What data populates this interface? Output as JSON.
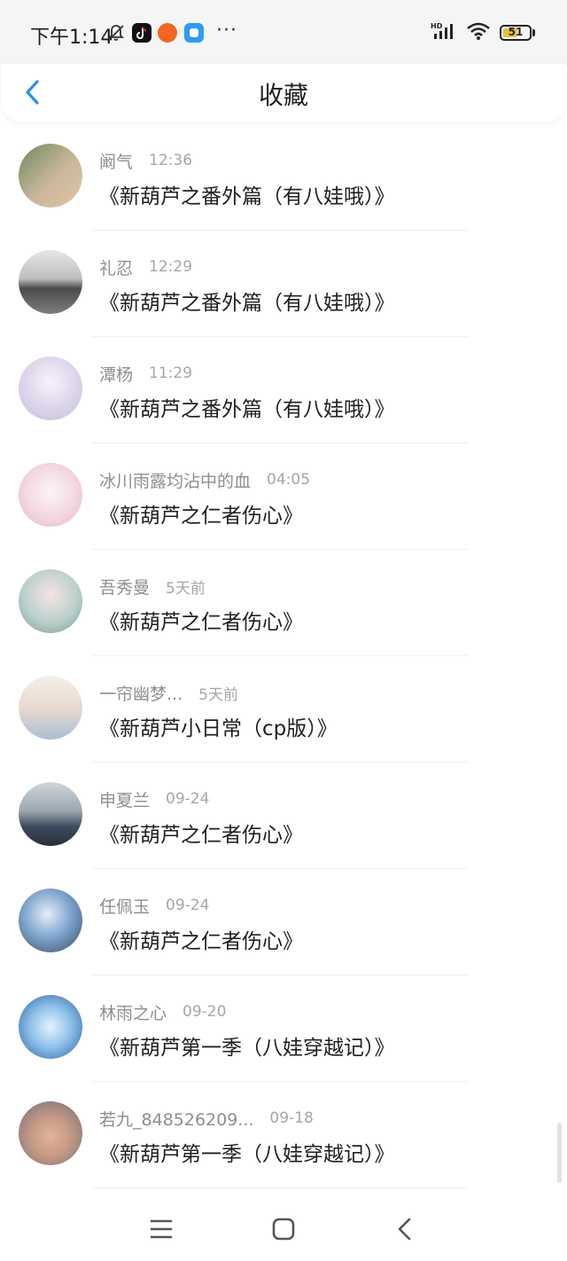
{
  "status_bar": {
    "time": "下午1:14",
    "icons": [
      "mute-bell-icon",
      "tiktok-app-icon",
      "pumpkin-app-icon",
      "blue-app-icon",
      "more-dots-icon",
      "hd-signal-icon",
      "wifi-icon",
      "battery-icon"
    ],
    "more": "···",
    "battery_level": "51"
  },
  "header": {
    "title": "收藏",
    "back_icon": "back-chevron-icon"
  },
  "items": [
    {
      "name": "阚气",
      "time": "12:36",
      "work": "《新葫芦之番外篇（有八娃哦）》"
    },
    {
      "name": "礼忍",
      "time": "12:29",
      "work": "《新葫芦之番外篇（有八娃哦）》"
    },
    {
      "name": "潭杨",
      "time": "11:29",
      "work": "《新葫芦之番外篇（有八娃哦）》"
    },
    {
      "name": "冰川雨露均沾中的血",
      "time": "04:05",
      "work": "《新葫芦之仁者伤心》"
    },
    {
      "name": "吾秀曼",
      "time": "5天前",
      "work": "《新葫芦之仁者伤心》"
    },
    {
      "name": "一帘幽梦...",
      "time": "5天前",
      "work": "《新葫芦小日常（cp版）》"
    },
    {
      "name": "申夏兰",
      "time": "09-24",
      "work": "《新葫芦之仁者伤心》"
    },
    {
      "name": "任佩玉",
      "time": "09-24",
      "work": "《新葫芦之仁者伤心》"
    },
    {
      "name": "林雨之心",
      "time": "09-20",
      "work": "《新葫芦第一季（八娃穿越记）》"
    },
    {
      "name": "若九_848526209...",
      "time": "09-18",
      "work": "《新葫芦第一季（八娃穿越记）》"
    }
  ],
  "nav": {
    "icons": [
      "menu-icon",
      "home-square-icon",
      "back-triangle-icon"
    ]
  },
  "colors": {
    "accent": "#2b8ef0",
    "name": "#8e8e8e",
    "time": "#a6a6a6",
    "divider": "#efefef"
  }
}
